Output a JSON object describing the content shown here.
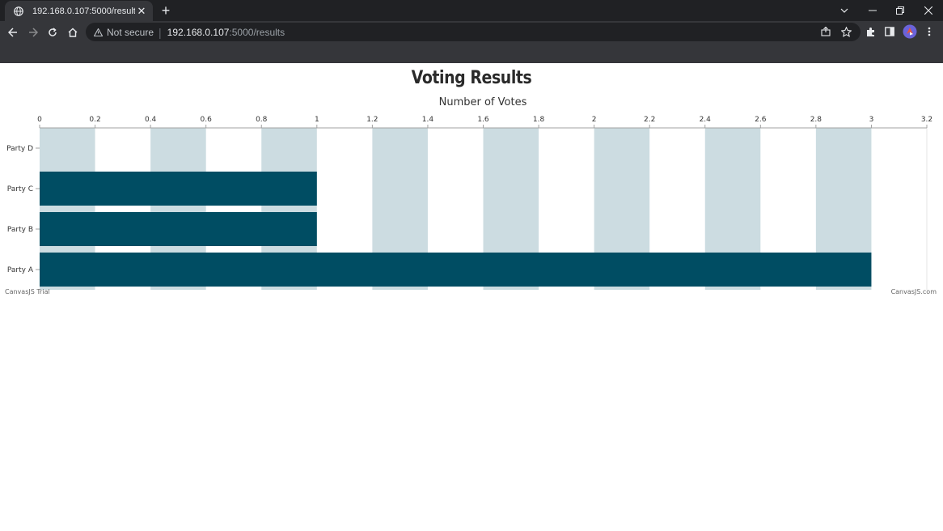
{
  "browser": {
    "tab_title": "192.168.0.107:5000/results",
    "tab_close": "✕",
    "new_tab": "+",
    "security_label": "Not secure",
    "url_host": "192.168.0.107",
    "url_path": ":5000/results"
  },
  "page": {
    "left_credit": "CanvasJS Trial",
    "right_credit": "CanvasJS.com"
  },
  "colors": {
    "bar": "#004d63",
    "stripe": "#ccdce1",
    "axis": "#a0a0a0",
    "label": "#333333"
  },
  "chart_data": {
    "type": "bar",
    "orientation": "horizontal",
    "title": "Voting Results",
    "value_axis_title": "Number of Votes",
    "value_axis_position": "top",
    "categories": [
      "Party A",
      "Party B",
      "Party C",
      "Party D"
    ],
    "values": [
      3,
      1,
      1,
      0
    ],
    "xlim": [
      0,
      3.2
    ],
    "tick_interval": 0.2,
    "tick_labels": [
      "0",
      "0.2",
      "0.4",
      "0.6",
      "0.8",
      "1",
      "1.2",
      "1.4",
      "1.6",
      "1.8",
      "2",
      "2.2",
      "2.4",
      "2.6",
      "2.8",
      "3",
      "3.2"
    ],
    "interlaced_grid": true,
    "legend": false
  }
}
